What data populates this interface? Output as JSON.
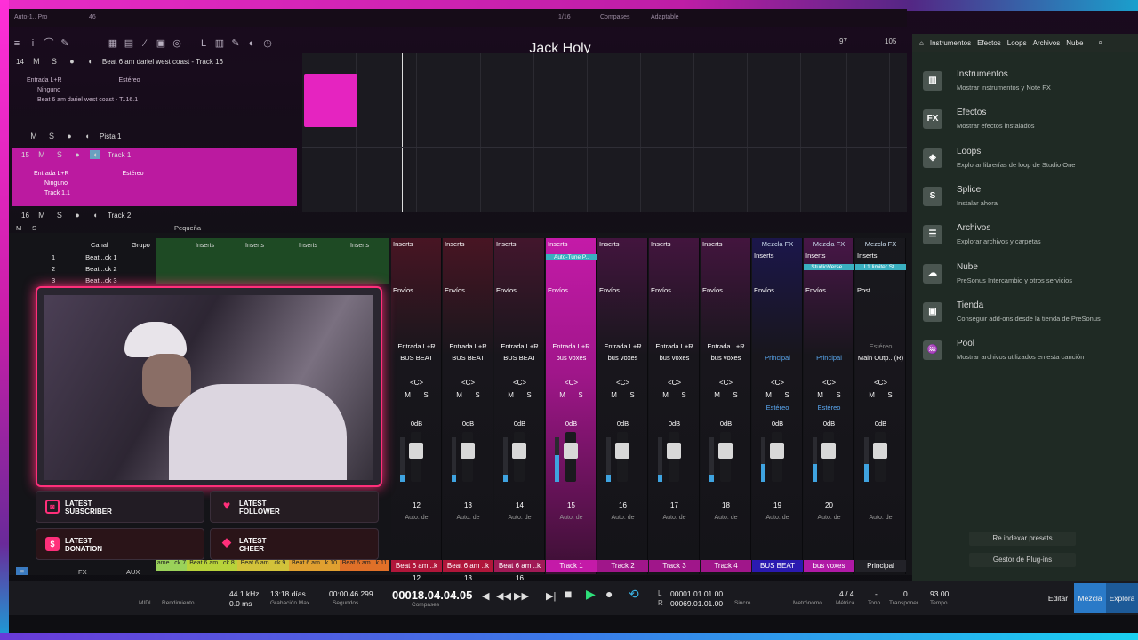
{
  "app": {
    "title": "Jack Holy",
    "window_label": "Auto-1.. Pro"
  },
  "topbar": {
    "num": "46",
    "meter": "1/16",
    "compases": "Compases",
    "adaptable": "Adaptable"
  },
  "ruler": {
    "marks": [
      "97",
      "105"
    ]
  },
  "tracks": [
    {
      "num": "14",
      "name": "Beat 6 am dariel west coast - Track 16",
      "input": "Entrada L+R",
      "stereo": "Estéreo",
      "output": "Ninguno",
      "send": "Beat 6 am dariel west coast - T..16.1"
    },
    {
      "num": "",
      "name": "Pista 1"
    },
    {
      "num": "15",
      "name": "Track 1",
      "input": "Entrada L+R",
      "stereo": "Estéreo",
      "output": "Ninguno",
      "send": "Track 1.1"
    },
    {
      "num": "16",
      "name": "Track 2"
    }
  ],
  "trackbar": {
    "m": "M",
    "s": "S",
    "size": "Pequeña"
  },
  "track_btns": {
    "m": "M",
    "s": "S"
  },
  "browser": {
    "tabs": [
      "Instrumentos",
      "Efectos",
      "Loops",
      "Archivos",
      "Nube"
    ],
    "items": [
      {
        "icon": "piano-icon",
        "glyph": "▥",
        "title": "Instrumentos",
        "desc": "Mostrar instrumentos y Note FX"
      },
      {
        "icon": "fx-icon",
        "glyph": "FX",
        "title": "Efectos",
        "desc": "Mostrar efectos instalados"
      },
      {
        "icon": "loops-icon",
        "glyph": "◈",
        "title": "Loops",
        "desc": "Explorar librerías de loop de Studio One"
      },
      {
        "icon": "splice-icon",
        "glyph": "S",
        "title": "Splice",
        "desc": "Instalar ahora"
      },
      {
        "icon": "files-icon",
        "glyph": "☰",
        "title": "Archivos",
        "desc": "Explorar archivos y carpetas"
      },
      {
        "icon": "cloud-icon",
        "glyph": "☁",
        "title": "Nube",
        "desc": "PreSonus Intercambio y otros servicios"
      },
      {
        "icon": "shop-icon",
        "glyph": "▣",
        "title": "Tienda",
        "desc": "Conseguir add-ons desde la tienda de PreSonus"
      },
      {
        "icon": "pool-icon",
        "glyph": "♒",
        "title": "Pool",
        "desc": "Mostrar archivos utilizados en esta canción"
      }
    ],
    "reindex": "Re indexar presets",
    "plugin_manager": "Gestor de Plug-ins"
  },
  "chlist": {
    "canal": "Canal",
    "grupo": "Grupo",
    "rows": [
      {
        "n": "1",
        "name": "Beat ..ck 1"
      },
      {
        "n": "2",
        "name": "Beat ..ck 2"
      },
      {
        "n": "3",
        "name": "Beat ..ck 3"
      }
    ]
  },
  "mixer": {
    "inserts_label": "Inserts",
    "envios_label": "Envíos",
    "strip_c": "<C>",
    "db": "0dB",
    "auto": "Auto: de",
    "m": "M",
    "s": "S",
    "bottom_names": [
      "ame ..ck 7",
      "Beat 6 am ..ck 8",
      "Beat 6 am ..ck 9",
      "Beat 6 am ..k 10",
      "Beat 6 am ..k 11"
    ],
    "strips": [
      {
        "num": "12",
        "input": "Entrada L+R",
        "bus": "BUS BEAT",
        "name": "Beat 6 am ..k 12",
        "color": "#b0163a",
        "insert": "Inserts"
      },
      {
        "num": "13",
        "input": "Entrada L+R",
        "bus": "BUS BEAT",
        "name": "Beat 6 am ..k 13",
        "color": "#b0163a",
        "insert": "Inserts"
      },
      {
        "num": "14",
        "input": "Entrada L+R",
        "bus": "BUS BEAT",
        "name": "Beat 6 am ..k 16",
        "color": "#a01a56",
        "insert": "Inserts"
      },
      {
        "num": "15",
        "input": "Entrada L+R",
        "bus": "bus voxes",
        "name": "Track 1",
        "color": "#c41aa8",
        "insert": "Inserts",
        "plugin": "Auto-Tune P.."
      },
      {
        "num": "16",
        "input": "Entrada L+R",
        "bus": "bus voxes",
        "name": "Track 2",
        "color": "#a0168a",
        "insert": "Inserts"
      },
      {
        "num": "17",
        "input": "Entrada L+R",
        "bus": "bus voxes",
        "name": "Track 3",
        "color": "#a0168a",
        "insert": "Inserts"
      },
      {
        "num": "18",
        "input": "Entrada L+R",
        "bus": "bus voxes",
        "name": "Track 4",
        "color": "#a0168a",
        "insert": "Inserts"
      },
      {
        "num": "19",
        "input": "",
        "bus": "Principal",
        "name": "BUS BEAT",
        "color": "#2a1ab0",
        "insert": "Inserts",
        "fx": "Mezcla FX",
        "mode": "Estéreo"
      },
      {
        "num": "20",
        "input": "",
        "bus": "Principal",
        "name": "bus voxes",
        "color": "#b01aa6",
        "insert": "Inserts",
        "fx": "Mezcla FX",
        "plugin": "StudioVerse ..",
        "mode": "Estéreo"
      },
      {
        "num": "",
        "input": "Estéreo",
        "bus": "Main Outp.. (R)",
        "name": "Principal",
        "color": "#222228",
        "insert": "Inserts",
        "fx": "Mezcla FX",
        "plugin": "L1 limiter St..",
        "post": "Post",
        "mode": ""
      }
    ]
  },
  "alerts": [
    {
      "icon": "twitch-icon",
      "glyph": "◙",
      "l1": "LATEST",
      "l2": "SUBSCRIBER"
    },
    {
      "icon": "heart-icon",
      "glyph": "♥",
      "l1": "LATEST",
      "l2": "FOLLOWER"
    },
    {
      "icon": "donation-icon",
      "glyph": "$",
      "l1": "LATEST",
      "l2": "DONATION"
    },
    {
      "icon": "cheer-icon",
      "glyph": "◆",
      "l1": "LATEST",
      "l2": "CHEER"
    }
  ],
  "transport": {
    "midi": "MIDI",
    "rendimiento": "Rendimiento",
    "rate": "44.1 kHz",
    "latency": "0.0 ms",
    "days": "13:18 días",
    "grab": "Grabación Max",
    "seconds_val": "00:00:46.299",
    "seconds": "Segundos",
    "timecode": "00018.04.04.05",
    "compases": "Compases",
    "l_pos": "00001.01.01.00",
    "r_pos": "00069.01.01.00",
    "l": "L",
    "r": "R",
    "sincro": "Sincro.",
    "metronomo": "Metrónomo",
    "metrica_val": "4 / 4",
    "metrica": "Métrica",
    "tono": "Tono",
    "tono_val": "-",
    "transponer_val": "0",
    "transponer": "Transponer",
    "tempo_val": "93.00",
    "tempo": "Tempo",
    "editar": "Editar",
    "mezcla": "Mezcla",
    "explorar": "Explora"
  },
  "bottomtabs": {
    "fx": "FX",
    "aux": "AUX"
  }
}
